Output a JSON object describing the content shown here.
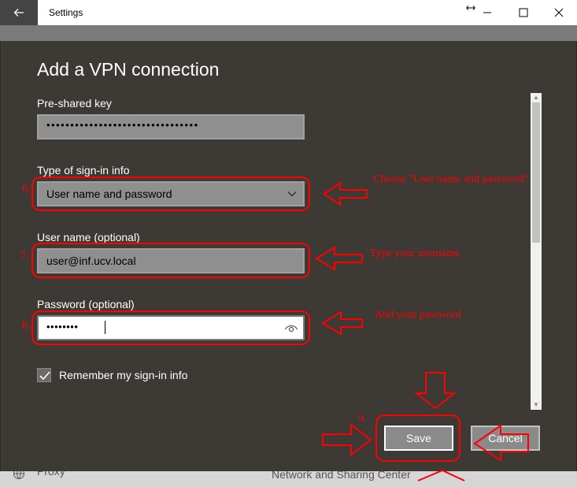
{
  "window": {
    "title": "Settings",
    "back_icon": "back-arrow-icon",
    "resize_icon": "resize-arrows-icon",
    "minimize_icon": "minimize-icon",
    "maximize_icon": "maximize-icon",
    "close_icon": "close-icon"
  },
  "background": {
    "proxy_label": "Proxy",
    "network_link": "Network and Sharing Center"
  },
  "dialog": {
    "heading": "Add a VPN connection",
    "preshared_key": {
      "label": "Pre-shared key",
      "value": "••••••••••••••••••••••••••••••••"
    },
    "signin_type": {
      "label": "Type of sign-in info",
      "value": "User name and password"
    },
    "username": {
      "label": "User name (optional)",
      "value": "user@inf.ucv.local"
    },
    "password": {
      "label": "Password (optional)",
      "value": "••••••••"
    },
    "remember": {
      "label": "Remember my sign-in info",
      "checked": true
    },
    "save_label": "Save",
    "cancel_label": "Cancel"
  },
  "annotations": {
    "step6": "6.",
    "step7": "7.",
    "step8": "8.",
    "step9": "9.",
    "note6": "Choose \"User name and password\"",
    "note7": "Type your username",
    "note8": "And your password",
    "color": "#ff0000"
  }
}
